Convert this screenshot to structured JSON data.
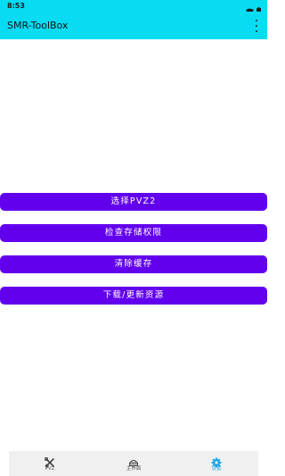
{
  "status_bar": {
    "time": "8:53",
    "icons": [
      "wifi-icon",
      "battery-icon"
    ]
  },
  "app_bar": {
    "title": "SMR-ToolBox",
    "menu_icon": "overflow-menu-icon"
  },
  "actions": [
    {
      "label": "选择PVZ2"
    },
    {
      "label": "检查存储权限"
    },
    {
      "label": "清除缓存"
    },
    {
      "label": "下载/更新资源"
    }
  ],
  "bottom_nav": {
    "items": [
      {
        "label": "PVZ",
        "icon": "tools-icon"
      },
      {
        "label": "主界面",
        "icon": "home-icon"
      },
      {
        "label": "设置",
        "icon": "gear-icon",
        "active": true
      }
    ]
  },
  "colors": {
    "accent": "#08dcf2",
    "button": "#6200ee",
    "nav_active": "#1aa6e8"
  }
}
